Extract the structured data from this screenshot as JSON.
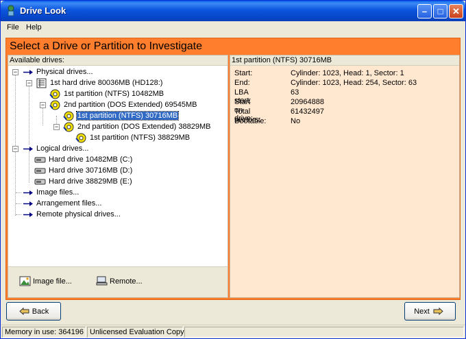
{
  "window": {
    "title": "Drive Look"
  },
  "menu": {
    "file": "File",
    "help": "Help"
  },
  "banner": "Select a Drive or Partition to Investigate",
  "left_panel": {
    "header": "Available drives:",
    "tree": [
      {
        "id": "physical",
        "label": "Physical drives...",
        "icon": "arrow-icon"
      },
      {
        "id": "hd1",
        "label": "1st hard drive 80036MB (HD128:)",
        "icon": "hard-drive-icon"
      },
      {
        "id": "p1",
        "label": "1st partition (NTFS) 10482MB",
        "icon": "partition-icon"
      },
      {
        "id": "p2",
        "label": "2nd partition (DOS Extended) 69545MB",
        "icon": "partition-icon"
      },
      {
        "id": "p2a",
        "label": "1st partition (NTFS) 30716MB",
        "icon": "partition-icon"
      },
      {
        "id": "p2b",
        "label": "2nd partition (DOS Extended) 38829MB",
        "icon": "partition-icon"
      },
      {
        "id": "p2b1",
        "label": "1st partition (NTFS) 38829MB",
        "icon": "partition-icon"
      },
      {
        "id": "logical",
        "label": "Logical drives...",
        "icon": "arrow-icon"
      },
      {
        "id": "c",
        "label": "Hard drive 10482MB (C:)",
        "icon": "disk-icon"
      },
      {
        "id": "d",
        "label": "Hard drive 30716MB (D:)",
        "icon": "disk-icon"
      },
      {
        "id": "e",
        "label": "Hard drive 38829MB (E:)",
        "icon": "disk-icon"
      },
      {
        "id": "image",
        "label": "Image files...",
        "icon": "arrow-icon"
      },
      {
        "id": "arr",
        "label": "Arrangement files...",
        "icon": "arrow-icon"
      },
      {
        "id": "remote",
        "label": "Remote physical drives...",
        "icon": "arrow-icon"
      }
    ],
    "image_file_btn": "Image file...",
    "remote_btn": "Remote..."
  },
  "right_panel": {
    "header": "1st partition (NTFS) 30716MB",
    "properties": [
      {
        "key": "Start:",
        "value": "Cylinder: 1023, Head: 1, Sector: 1"
      },
      {
        "key": "End:",
        "value": "Cylinder: 1023, Head: 254, Sector: 63"
      },
      {
        "key": "LBA start:",
        "value": "63"
      },
      {
        "key": "Start on drive:",
        "value": "20964888"
      },
      {
        "key": "Total sectors:",
        "value": "61432497"
      },
      {
        "key": "Bootable:",
        "value": "No"
      }
    ]
  },
  "buttons": {
    "back": "Back",
    "next": "Next"
  },
  "status": {
    "memory": "Memory in use: 364196",
    "license": "Unlicensed Evaluation Copy"
  },
  "colors": {
    "accent_orange": "#FF7E2E",
    "selection": "#316AC5",
    "title_blue": "#0B55DD"
  }
}
